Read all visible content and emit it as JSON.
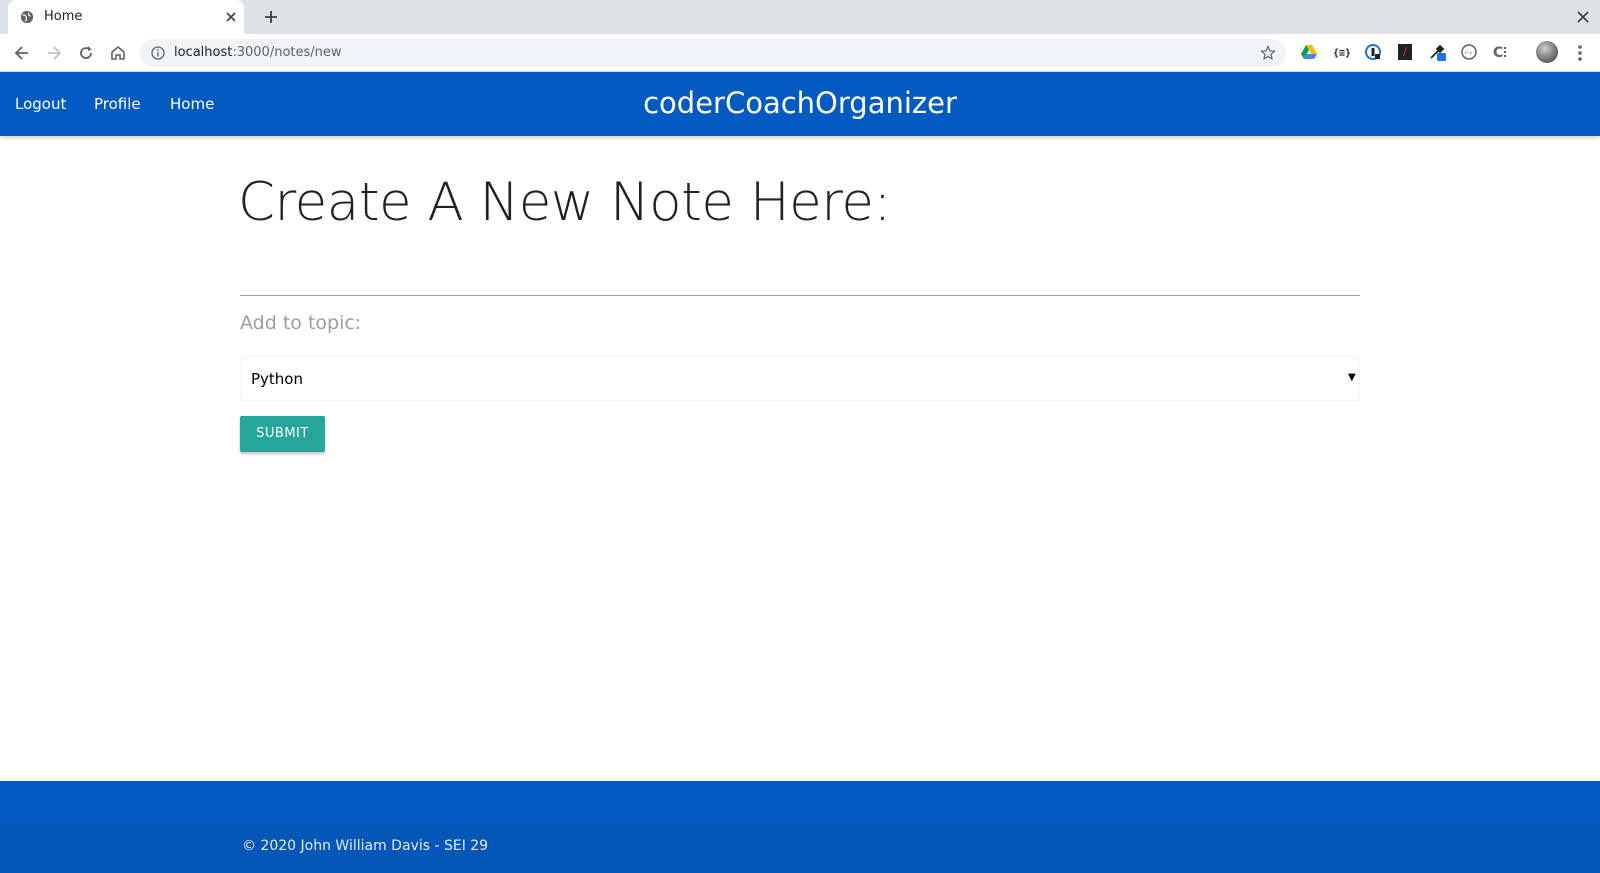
{
  "browser": {
    "tab_title": "Home",
    "url_host": "localhost",
    "url_rest": ":3000/notes/new",
    "extensions": [
      "google-drive-icon",
      "json-viewer-icon",
      "password-manager-icon",
      "pdf-extension-icon",
      "color-picker-icon",
      "wappalyzer-icon",
      "css-peeper-icon"
    ]
  },
  "nav": {
    "brand": "coderCoachOrganizer",
    "links": [
      "Logout",
      "Profile",
      "Home"
    ]
  },
  "form": {
    "title": "Create A New Note Here:",
    "note_value": "",
    "topic_label": "Add to topic:",
    "topic_selected": "Python",
    "submit_label": "SUBMIT"
  },
  "footer": {
    "copyright": "© 2020 John William Davis - SEI 29"
  },
  "colors": {
    "nav_bg": "#035bc2",
    "submit_bg": "#26a69a",
    "footer_bg": "#035bc2"
  }
}
